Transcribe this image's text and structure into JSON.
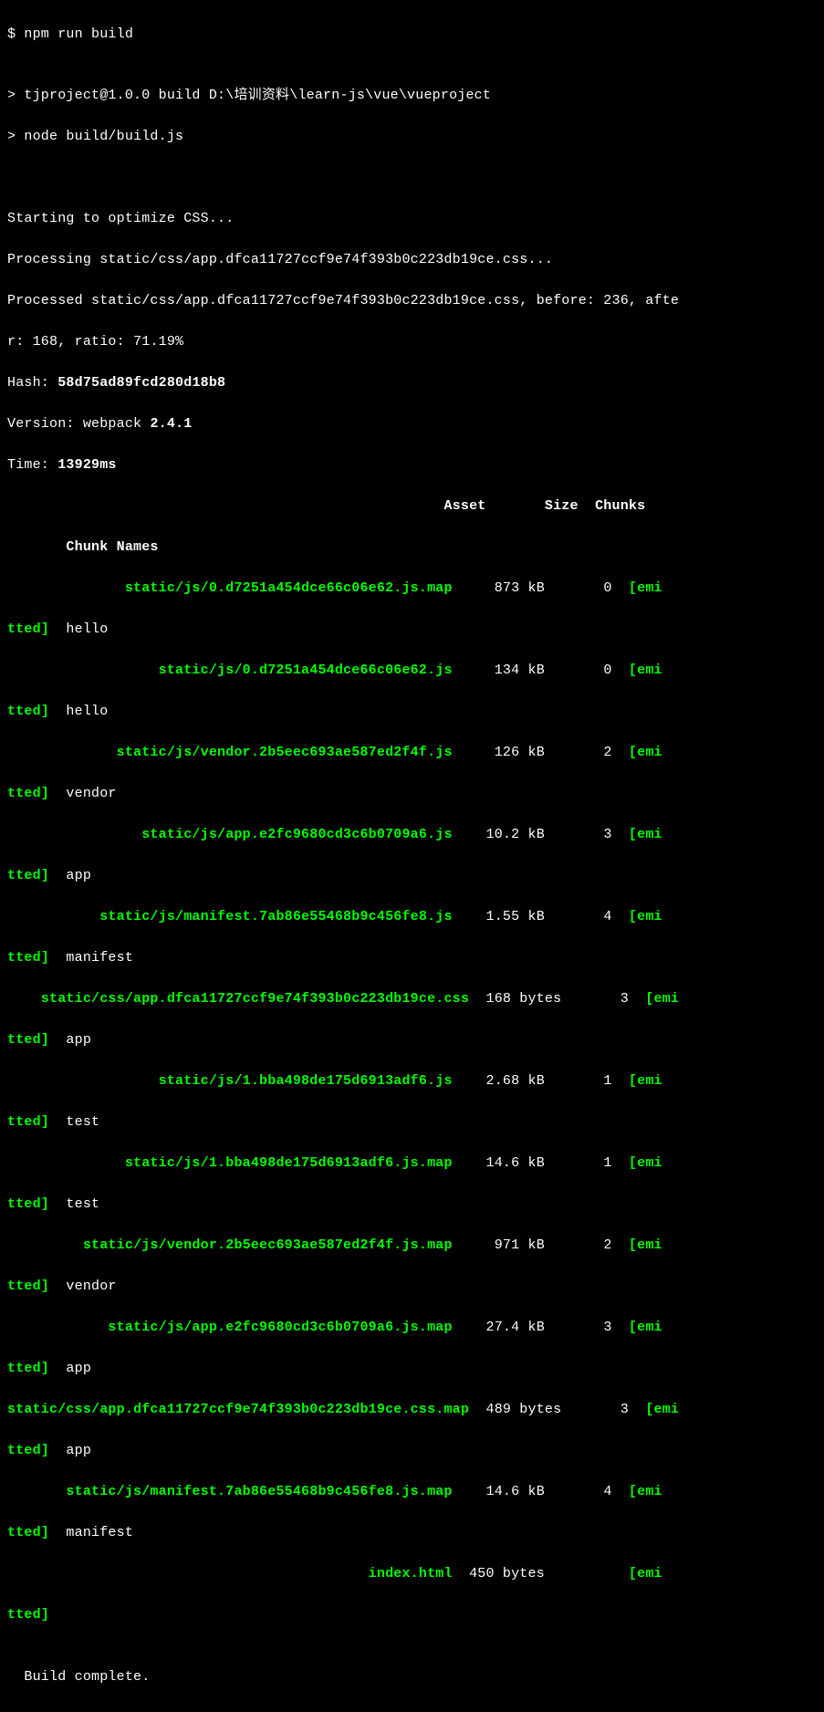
{
  "prompt": "$ npm run build",
  "blank1": "",
  "script_line1": "> tjproject@1.0.0 build D:\\培训资料\\learn-js\\vue\\vueproject",
  "script_line2": "> node build/build.js",
  "blank2": "",
  "blank3": "",
  "css1": "Starting to optimize CSS...",
  "css2": "Processing static/css/app.dfca11727ccf9e74f393b0c223db19ce.css...",
  "css3": "Processed static/css/app.dfca11727ccf9e74f393b0c223db19ce.css, before: 236, afte",
  "css4": "r: 168, ratio: 71.19%",
  "hash_label": "Hash: ",
  "hash_value": "58d75ad89fcd280d18b8",
  "version_label": "Version: webpack ",
  "version_value": "2.4.1",
  "time_label": "Time: ",
  "time_value": "13929ms",
  "header1": "                                                    Asset       Size  Chunks",
  "header2": "       Chunk Names",
  "r1a_asset": "              static/js/0.d7251a454dce66c06e62.js.map",
  "r1a_rest": "     873 kB       0  ",
  "r1a_emi": "[emi",
  "r1b_tted": "tted]",
  "r1b_name": "  hello",
  "r2a_asset": "                  static/js/0.d7251a454dce66c06e62.js",
  "r2a_rest": "     134 kB       0  ",
  "r2a_emi": "[emi",
  "r2b_tted": "tted]",
  "r2b_name": "  hello",
  "r3a_asset": "             static/js/vendor.2b5eec693ae587ed2f4f.js",
  "r3a_rest": "     126 kB       2  ",
  "r3a_emi": "[emi",
  "r3b_tted": "tted]",
  "r3b_name": "  vendor",
  "r4a_asset": "                static/js/app.e2fc9680cd3c6b0709a6.js",
  "r4a_rest": "    10.2 kB       3  ",
  "r4a_emi": "[emi",
  "r4b_tted": "tted]",
  "r4b_name": "  app",
  "r5a_asset": "           static/js/manifest.7ab86e55468b9c456fe8.js",
  "r5a_rest": "    1.55 kB       4  ",
  "r5a_emi": "[emi",
  "r5b_tted": "tted]",
  "r5b_name": "  manifest",
  "r6a_asset": "    static/css/app.dfca11727ccf9e74f393b0c223db19ce.css",
  "r6a_rest": "  168 bytes       3  ",
  "r6a_emi": "[emi",
  "r6b_tted": "tted]",
  "r6b_name": "  app",
  "r7a_asset": "                  static/js/1.bba498de175d6913adf6.js",
  "r7a_rest": "    2.68 kB       1  ",
  "r7a_emi": "[emi",
  "r7b_tted": "tted]",
  "r7b_name": "  test",
  "r8a_asset": "              static/js/1.bba498de175d6913adf6.js.map",
  "r8a_rest": "    14.6 kB       1  ",
  "r8a_emi": "[emi",
  "r8b_tted": "tted]",
  "r8b_name": "  test",
  "r9a_asset": "         static/js/vendor.2b5eec693ae587ed2f4f.js.map",
  "r9a_rest": "     971 kB       2  ",
  "r9a_emi": "[emi",
  "r9b_tted": "tted]",
  "r9b_name": "  vendor",
  "r10a_asset": "            static/js/app.e2fc9680cd3c6b0709a6.js.map",
  "r10a_rest": "    27.4 kB       3  ",
  "r10a_emi": "[emi",
  "r10b_tted": "tted]",
  "r10b_name": "  app",
  "r11a_asset": "static/css/app.dfca11727ccf9e74f393b0c223db19ce.css.map",
  "r11a_rest": "  489 bytes       3  ",
  "r11a_emi": "[emi",
  "r11b_tted": "tted]",
  "r11b_name": "  app",
  "r12a_asset": "       static/js/manifest.7ab86e55468b9c456fe8.js.map",
  "r12a_rest": "    14.6 kB       4  ",
  "r12a_emi": "[emi",
  "r12b_tted": "tted]",
  "r12b_name": "  manifest",
  "r13a_asset": "                                           index.html",
  "r13a_rest": "  450 bytes          ",
  "r13a_emi": "[emi",
  "r13b_tted": "tted]",
  "blank4": "",
  "complete": "  Build complete."
}
